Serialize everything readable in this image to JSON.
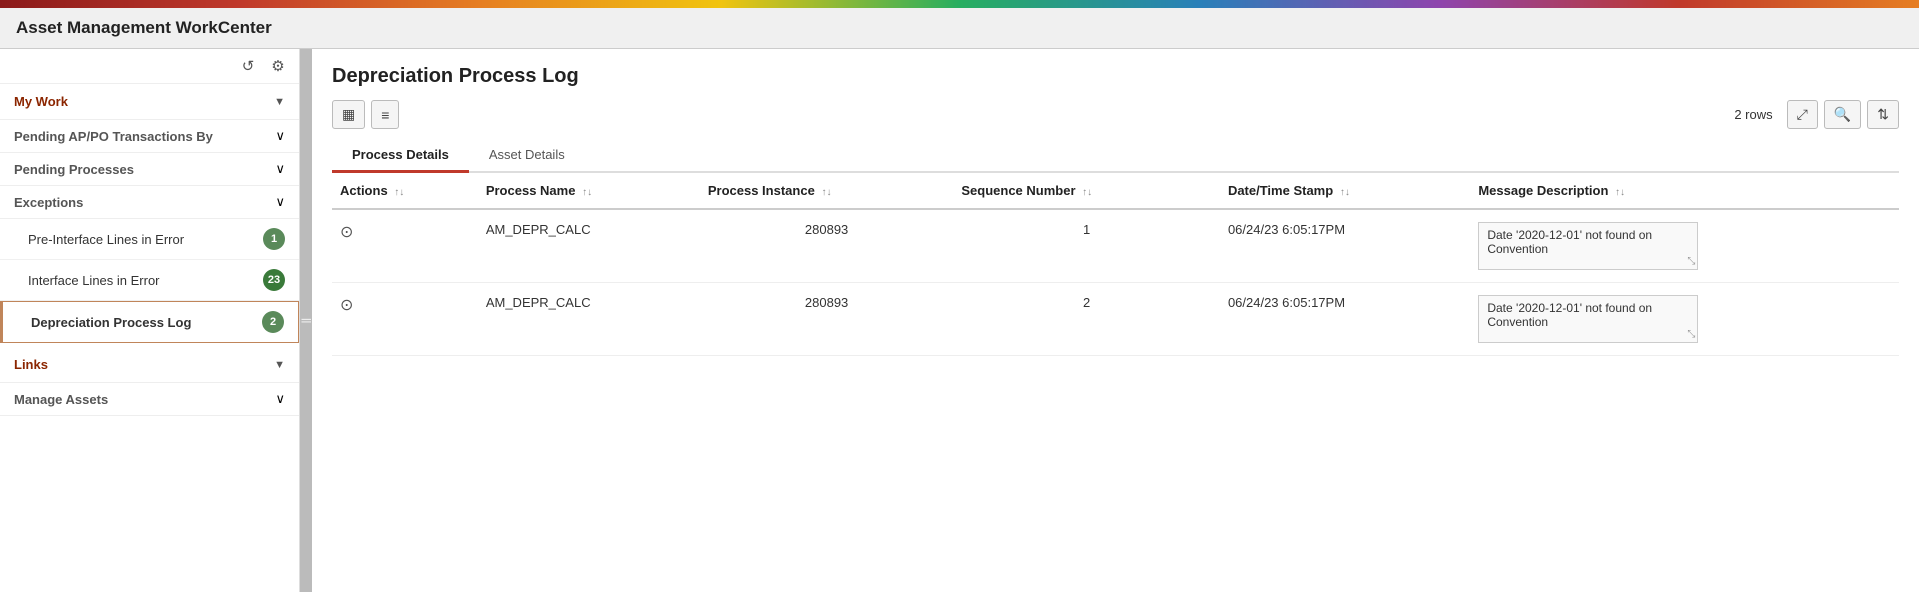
{
  "app": {
    "title": "Asset Management WorkCenter"
  },
  "sidebar": {
    "refresh_icon": "↺",
    "settings_icon": "⚙",
    "sections": [
      {
        "id": "my-work",
        "label": "My Work",
        "collapsed": false,
        "items": [
          {
            "id": "pending-ap-po",
            "label": "Pending AP/PO Transactions By",
            "type": "collapse",
            "badge": null
          },
          {
            "id": "pending-processes",
            "label": "Pending Processes",
            "type": "collapse",
            "badge": null
          },
          {
            "id": "exceptions",
            "label": "Exceptions",
            "type": "collapse",
            "badge": null,
            "children": [
              {
                "id": "pre-interface-lines",
                "label": "Pre-Interface Lines in Error",
                "badge": "1",
                "badge_color": "badge-green"
              },
              {
                "id": "interface-lines",
                "label": "Interface Lines in Error",
                "badge": "23",
                "badge_color": "badge-green-bright"
              },
              {
                "id": "depreciation-process-log",
                "label": "Depreciation Process Log",
                "badge": "2",
                "badge_color": "badge-green",
                "active": true
              }
            ]
          }
        ]
      },
      {
        "id": "links",
        "label": "Links",
        "collapsed": false
      },
      {
        "id": "manage-assets",
        "label": "Manage Assets",
        "collapsed": false
      }
    ]
  },
  "content": {
    "page_title": "Depreciation Process Log",
    "rows_count": "2 rows",
    "toolbar": {
      "grid_icon": "▦",
      "filter_icon": "≡",
      "expand_icon": "⤢",
      "search_icon": "🔍",
      "sort_icon": "⇅"
    },
    "tabs": [
      {
        "id": "process-details",
        "label": "Process Details",
        "active": true
      },
      {
        "id": "asset-details",
        "label": "Asset Details",
        "active": false
      }
    ],
    "table": {
      "columns": [
        {
          "id": "actions",
          "label": "Actions"
        },
        {
          "id": "process-name",
          "label": "Process Name"
        },
        {
          "id": "process-instance",
          "label": "Process Instance"
        },
        {
          "id": "sequence-number",
          "label": "Sequence Number"
        },
        {
          "id": "datetime-stamp",
          "label": "Date/Time Stamp"
        },
        {
          "id": "message-description",
          "label": "Message Description"
        }
      ],
      "rows": [
        {
          "action": "○",
          "process_name": "AM_DEPR_CALC",
          "process_instance": "280893",
          "sequence_number": "1",
          "datetime_stamp": "06/24/23  6:05:17PM",
          "message_description": "Date '2020-12-01' not found on Convention"
        },
        {
          "action": "○",
          "process_name": "AM_DEPR_CALC",
          "process_instance": "280893",
          "sequence_number": "2",
          "datetime_stamp": "06/24/23  6:05:17PM",
          "message_description": "Date '2020-12-01' not found on Convention"
        }
      ]
    }
  }
}
